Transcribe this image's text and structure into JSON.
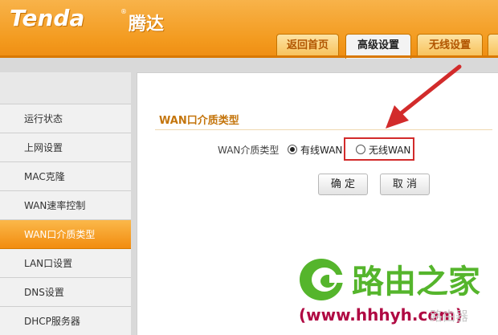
{
  "header": {
    "logo": "Tenda",
    "logo_reg": "®",
    "logo_cn": "腾达",
    "tabs": [
      "返回首页",
      "高级设置",
      "无线设置"
    ]
  },
  "sidebar": {
    "items": [
      "运行状态",
      "上网设置",
      "MAC克隆",
      "WAN速率控制",
      "WAN口介质类型",
      "LAN口设置",
      "DNS设置",
      "DHCP服务器"
    ],
    "selected": "WAN口介质类型"
  },
  "main": {
    "section_title": "WAN口介质类型",
    "field_label": "WAN介质类型",
    "options": [
      {
        "label": "有线WAN",
        "checked": true
      },
      {
        "label": "无线WAN",
        "checked": false
      }
    ],
    "buttons": {
      "ok": "确 定",
      "cancel": "取 消"
    }
  },
  "watermark": {
    "brand": "路由之家",
    "url": "(www.hhhyh.com)",
    "faint": "路由器"
  },
  "colors": {
    "accent": "#f39a1e",
    "highlight": "#d22b2b",
    "watermark_green": "#55b52c",
    "watermark_red": "#b00a43"
  }
}
